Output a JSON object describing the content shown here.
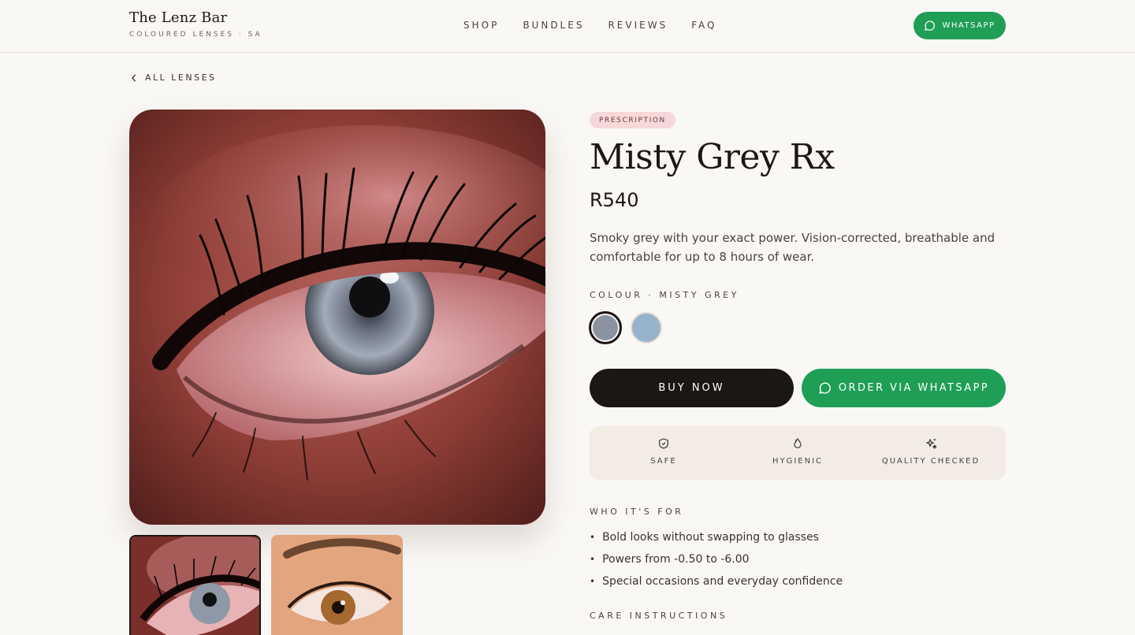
{
  "header": {
    "brand_name": "The Lenz Bar",
    "brand_tagline": "COLOURED LENSES · SA",
    "nav": [
      "SHOP",
      "BUNDLES",
      "REVIEWS",
      "FAQ"
    ],
    "whatsapp_label": "WHATSAPP"
  },
  "back_link": "ALL LENSES",
  "product": {
    "badge": "PRESCRIPTION",
    "title": "Misty Grey Rx",
    "price": "R540",
    "description": "Smoky grey with your exact power. Vision-corrected, breathable and comfortable for up to 8 hours of wear.",
    "colour_label": "COLOUR · MISTY GREY",
    "swatches": [
      {
        "name": "misty-grey",
        "color": "#8a93a0",
        "selected": true
      },
      {
        "name": "blue",
        "color": "#97b3cb",
        "selected": false
      }
    ],
    "buy_label": "BUY NOW",
    "whatsapp_order_label": "ORDER VIA WHATSAPP"
  },
  "features": [
    {
      "icon": "shield-icon",
      "label": "SAFE"
    },
    {
      "icon": "droplet-icon",
      "label": "HYGIENIC"
    },
    {
      "icon": "sparkle-icon",
      "label": "QUALITY CHECKED"
    }
  ],
  "who_label": "WHO IT'S FOR",
  "who_items": [
    "Bold looks without swapping to glasses",
    "Powers from -0.50 to -6.00",
    "Special occasions and everyday confidence"
  ],
  "care_label": "CARE INSTRUCTIONS",
  "colors": {
    "accent_green": "#1f9e55",
    "primary_dark": "#1c1614",
    "badge_pink": "#f7d8d8"
  }
}
